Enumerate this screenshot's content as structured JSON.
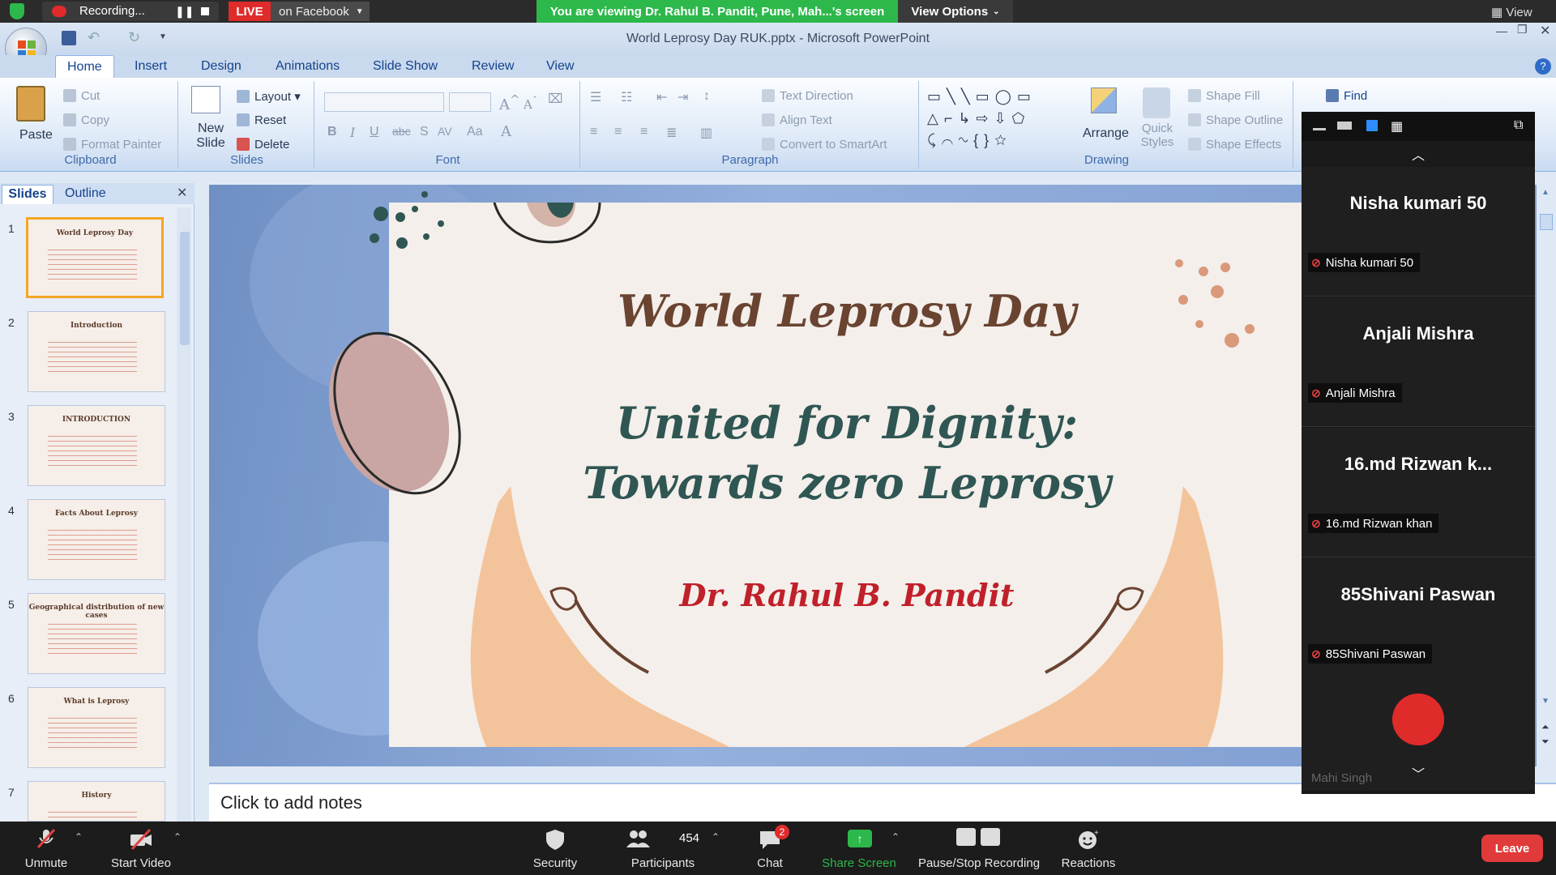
{
  "zoom_top": {
    "recording_label": "Recording...",
    "live_badge": "LIVE",
    "live_destination": "on Facebook",
    "viewing_banner": "You are viewing Dr. Rahul B. Pandit, Pune, Mah...'s screen",
    "view_options": "View Options",
    "view_label": "View"
  },
  "window": {
    "title": "World Leprosy Day RUK.pptx - Microsoft PowerPoint"
  },
  "tabs": [
    "Home",
    "Insert",
    "Design",
    "Animations",
    "Slide Show",
    "Review",
    "View"
  ],
  "ribbon": {
    "clipboard": {
      "label": "Clipboard",
      "paste": "Paste",
      "cut": "Cut",
      "copy": "Copy",
      "format_painter": "Format Painter"
    },
    "slides": {
      "label": "Slides",
      "new_slide": "New Slide",
      "layout": "Layout",
      "reset": "Reset",
      "delete": "Delete"
    },
    "font": {
      "label": "Font"
    },
    "paragraph": {
      "label": "Paragraph",
      "text_direction": "Text Direction",
      "align_text": "Align Text",
      "convert_smartart": "Convert to SmartArt"
    },
    "drawing": {
      "label": "Drawing",
      "arrange": "Arrange",
      "quick_styles": "Quick Styles",
      "shape_fill": "Shape Fill",
      "shape_outline": "Shape Outline",
      "shape_effects": "Shape Effects"
    },
    "editing": {
      "find": "Find"
    }
  },
  "slides_pane": {
    "tab_slides": "Slides",
    "tab_outline": "Outline",
    "thumbnails": [
      {
        "num": "1",
        "title": "World Leprosy Day"
      },
      {
        "num": "2",
        "title": "Introduction"
      },
      {
        "num": "3",
        "title": "INTRODUCTION"
      },
      {
        "num": "4",
        "title": "Facts About Leprosy"
      },
      {
        "num": "5",
        "title": "Geographical distribution of new cases"
      },
      {
        "num": "6",
        "title": "What is Leprosy"
      },
      {
        "num": "7",
        "title": "History"
      }
    ]
  },
  "slide": {
    "title": "World Leprosy Day",
    "subtitle_line1": "United for Dignity:",
    "subtitle_line2": "Towards zero Leprosy",
    "author": "Dr. Rahul B. Pandit"
  },
  "notes": {
    "placeholder": "Click to add notes"
  },
  "participants": [
    {
      "display": "Nisha kumari 50",
      "tag": "Nisha kumari 50"
    },
    {
      "display": "Anjali Mishra",
      "tag": "Anjali Mishra"
    },
    {
      "display": "16.md  Rizwan  k...",
      "tag": "16.md Rizwan khan"
    },
    {
      "display": "85Shivani Paswan",
      "tag": "85Shivani Paswan"
    }
  ],
  "partial_participant": "Mahi Singh",
  "zoom_bottom": {
    "unmute": "Unmute",
    "start_video": "Start Video",
    "security": "Security",
    "participants": "Participants",
    "participants_count": "454",
    "chat": "Chat",
    "chat_badge": "2",
    "share_screen": "Share Screen",
    "pause_stop": "Pause/Stop Recording",
    "reactions": "Reactions",
    "leave": "Leave"
  },
  "colors": {
    "live_red": "#e02b2b",
    "banner_green": "#2db84b",
    "leave_red": "#e03a3a",
    "title_brown": "#6a4331",
    "subtitle_teal": "#2f5653",
    "author_red": "#c0202a"
  }
}
